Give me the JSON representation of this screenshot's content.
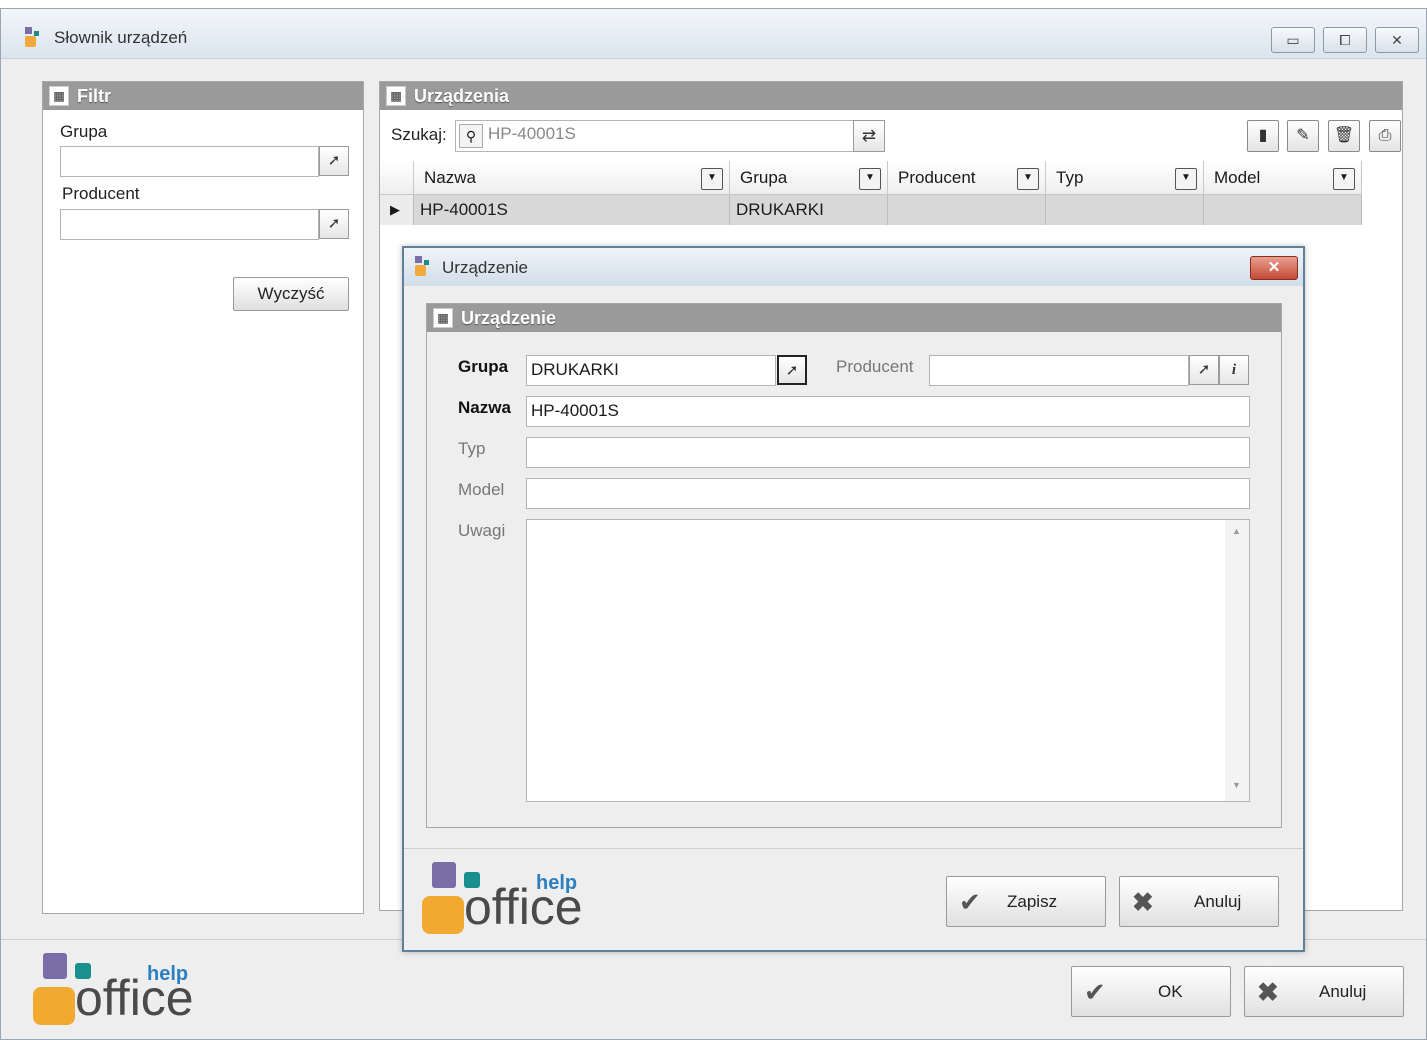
{
  "window": {
    "title": "Słownik urządzeń",
    "controls": {
      "minimize": "▭",
      "maximize": "⧠",
      "close": "✕"
    }
  },
  "filter": {
    "header": "Filtr",
    "grupa_label": "Grupa",
    "grupa_value": "",
    "producent_label": "Producent",
    "producent_value": "",
    "clear_button": "Wyczyść"
  },
  "devices": {
    "header": "Urządzenia",
    "search_label": "Szukaj:",
    "search_value": "HP-40001S",
    "columns": [
      "Nazwa",
      "Grupa",
      "Producent",
      "Typ",
      "Model"
    ],
    "rows": [
      {
        "nazwa": "HP-40001S",
        "grupa": "DRUKARKI",
        "producent": "",
        "typ": "",
        "model": ""
      }
    ]
  },
  "dialog": {
    "title": "Urządzenie",
    "header": "Urządzenie",
    "grupa_label": "Grupa",
    "grupa_value": "DRUKARKI",
    "producent_label": "Producent",
    "producent_value": "",
    "nazwa_label": "Nazwa",
    "nazwa_value": "HP-40001S",
    "typ_label": "Typ",
    "typ_value": "",
    "model_label": "Model",
    "model_value": "",
    "uwagi_label": "Uwagi",
    "uwagi_value": "",
    "save_button": "Zapisz",
    "cancel_button": "Anuluj"
  },
  "footer": {
    "ok_button": "OK",
    "cancel_button": "Anuluj"
  },
  "logo": {
    "small": "help",
    "big": "office"
  },
  "icons": {
    "grid": "grid-icon",
    "pick": "cursor-icon",
    "info": "info-icon",
    "search": "search-icon",
    "refresh": "refresh-icon",
    "new": "new-document-icon",
    "edit": "pencil-icon",
    "delete": "trash-icon",
    "print": "printer-icon",
    "check": "checkmark-icon",
    "cross": "cross-icon"
  },
  "colors": {
    "panel_header": "#9a9a9a",
    "dialog_border": "#5f7f9d",
    "close_red": "#c44a36",
    "logo_purple": "#7a6da8",
    "logo_teal": "#17908e",
    "logo_orange": "#f2a930",
    "logo_blue": "#2c7fc0"
  }
}
